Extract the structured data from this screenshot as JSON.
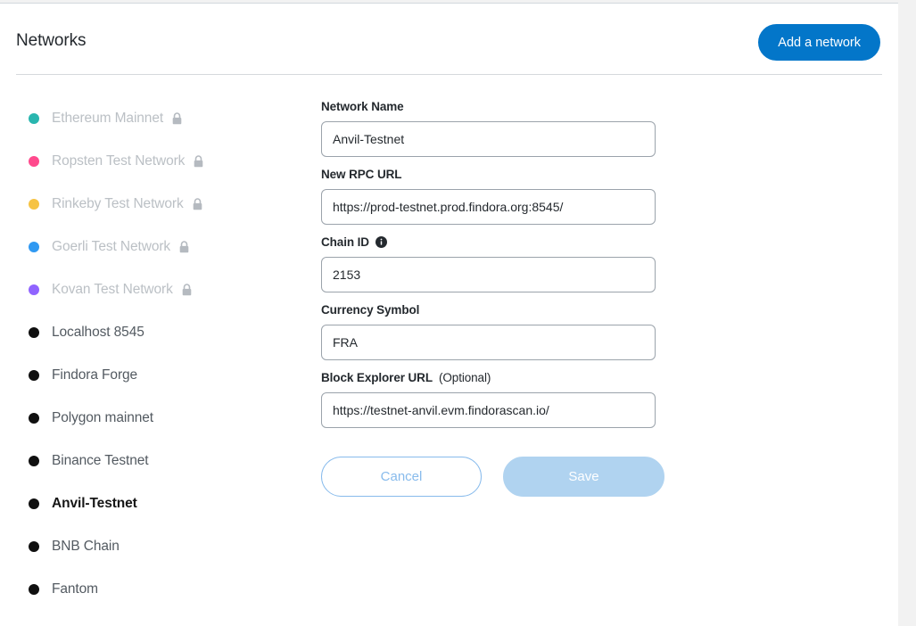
{
  "header": {
    "title": "Networks",
    "add_network_label": "Add a network"
  },
  "networks": [
    {
      "name": "Ethereum Mainnet",
      "color": "#29b6af",
      "locked": true,
      "selected": false
    },
    {
      "name": "Ropsten Test Network",
      "color": "#ff4a8d",
      "locked": true,
      "selected": false
    },
    {
      "name": "Rinkeby Test Network",
      "color": "#f6c343",
      "locked": true,
      "selected": false
    },
    {
      "name": "Goerli Test Network",
      "color": "#3099f2",
      "locked": true,
      "selected": false
    },
    {
      "name": "Kovan Test Network",
      "color": "#9064ff",
      "locked": true,
      "selected": false
    },
    {
      "name": "Localhost 8545",
      "color": "#101010",
      "locked": false,
      "selected": false
    },
    {
      "name": "Findora Forge",
      "color": "#101010",
      "locked": false,
      "selected": false
    },
    {
      "name": "Polygon mainnet",
      "color": "#101010",
      "locked": false,
      "selected": false
    },
    {
      "name": "Binance Testnet",
      "color": "#101010",
      "locked": false,
      "selected": false
    },
    {
      "name": "Anvil-Testnet",
      "color": "#101010",
      "locked": false,
      "selected": true
    },
    {
      "name": "BNB Chain",
      "color": "#101010",
      "locked": false,
      "selected": false
    },
    {
      "name": "Fantom",
      "color": "#101010",
      "locked": false,
      "selected": false
    }
  ],
  "form": {
    "network_name": {
      "label": "Network Name",
      "value": "Anvil-Testnet",
      "placeholder": ""
    },
    "rpc_url": {
      "label": "New RPC URL",
      "value": "https://prod-testnet.prod.findora.org:8545/",
      "placeholder": ""
    },
    "chain_id": {
      "label": "Chain ID",
      "value": "2153",
      "placeholder": "",
      "info_icon": "info-icon"
    },
    "currency_symbol": {
      "label": "Currency Symbol",
      "value": "FRA",
      "placeholder": ""
    },
    "block_explorer_url": {
      "label": "Block Explorer URL",
      "optional_note": "(Optional)",
      "value": "https://testnet-anvil.evm.findorascan.io/",
      "placeholder": ""
    },
    "cancel_label": "Cancel",
    "save_label": "Save"
  },
  "icons": {
    "lock": "lock-icon"
  },
  "colors": {
    "accent": "#0376c9",
    "save_disabled": "#b0d3f0",
    "cancel_outline": "#88bbec",
    "input_border": "#9ba3ab",
    "locked_text": "#bbc0c5",
    "item_text": "#535a61"
  }
}
